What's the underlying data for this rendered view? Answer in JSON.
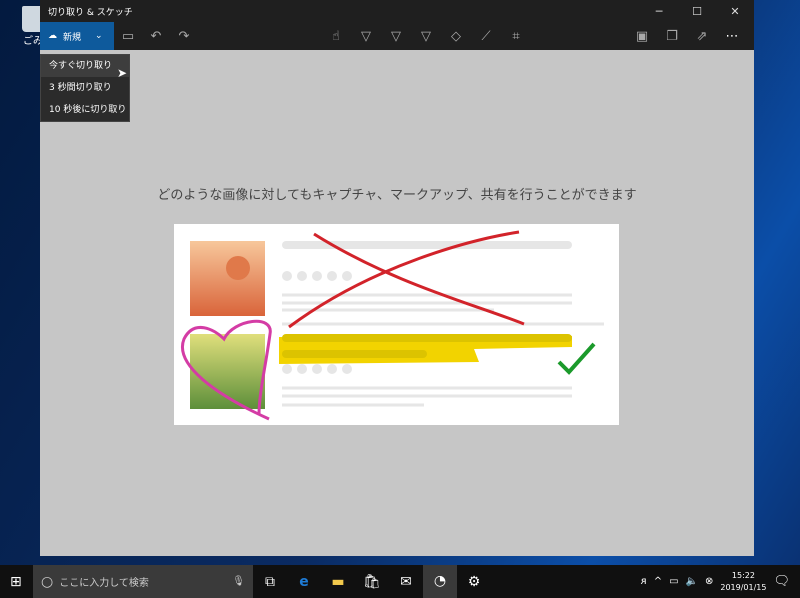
{
  "desktop": {
    "recycle_bin_label": "ごみ"
  },
  "window": {
    "title": "切り取り & スケッチ",
    "controls": {
      "minimize": "─",
      "maximize": "☐",
      "close": "✕"
    }
  },
  "toolbar": {
    "new_label": "新規",
    "icons": [
      "folder-icon",
      "undo-icon",
      "redo-icon"
    ],
    "tools": [
      "touch-writing-icon",
      "ballpoint-pen-icon",
      "pencil-icon",
      "highlighter-icon",
      "eraser-icon",
      "ruler-icon",
      "crop-icon"
    ],
    "right": [
      "save-icon",
      "copy-icon",
      "share-icon",
      "more-icon"
    ]
  },
  "menu": {
    "items": [
      "今すぐ切り取り",
      "3 秒間切り取り",
      "10 秒後に切り取り"
    ],
    "highlighted": 0
  },
  "main": {
    "headline": "どのような画像に対してもキャプチャ、マークアップ、共有を行うことができます"
  },
  "taskbar": {
    "search_placeholder": "ここに入力して検索",
    "time": "15:22",
    "date": "2019/01/15"
  }
}
